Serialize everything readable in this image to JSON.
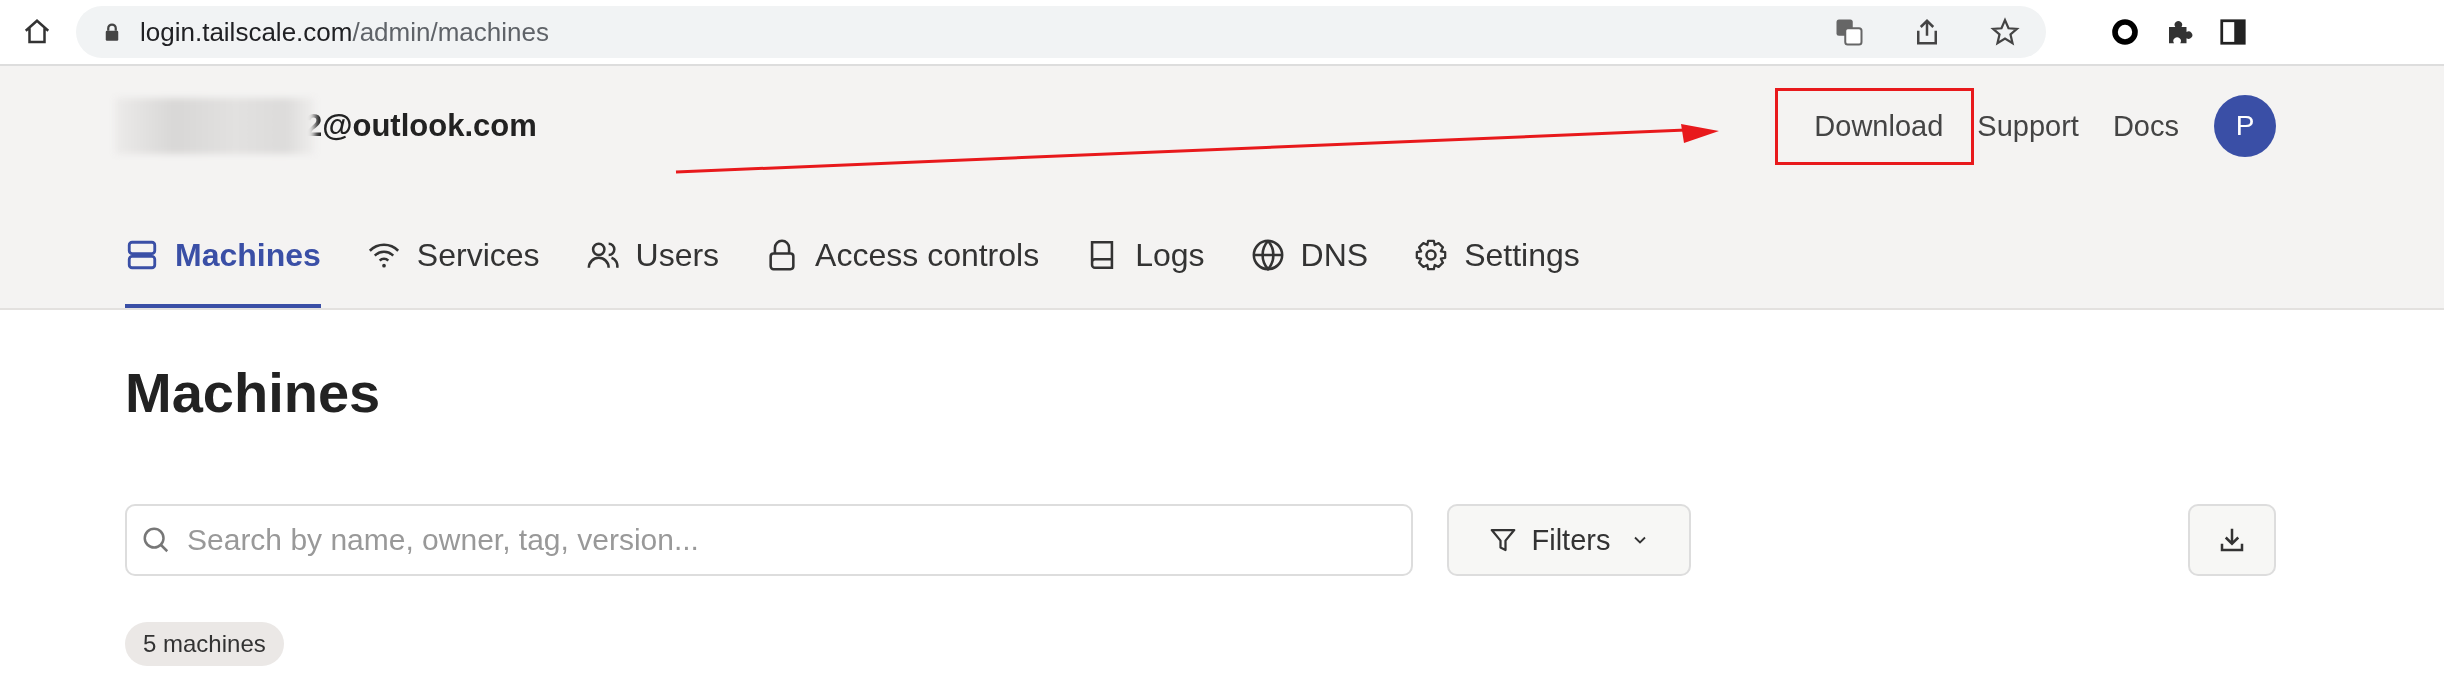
{
  "browser": {
    "url_host": "login.tailscale.com",
    "url_path": "/admin/machines"
  },
  "header": {
    "account_email": "2@outlook.com",
    "links": [
      {
        "label": "Download",
        "highlighted": true
      },
      {
        "label": "Support",
        "highlighted": false
      },
      {
        "label": "Docs",
        "highlighted": false
      }
    ],
    "avatar_initial": "P"
  },
  "tabs": [
    {
      "label": "Machines",
      "selected": true
    },
    {
      "label": "Services",
      "selected": false
    },
    {
      "label": "Users",
      "selected": false
    },
    {
      "label": "Access controls",
      "selected": false
    },
    {
      "label": "Logs",
      "selected": false
    },
    {
      "label": "DNS",
      "selected": false
    },
    {
      "label": "Settings",
      "selected": false
    }
  ],
  "page": {
    "title": "Machines",
    "search": {
      "placeholder": "Search by name, owner, tag, version..."
    },
    "filters_label": "Filters",
    "count_badge": "5 machines"
  }
}
